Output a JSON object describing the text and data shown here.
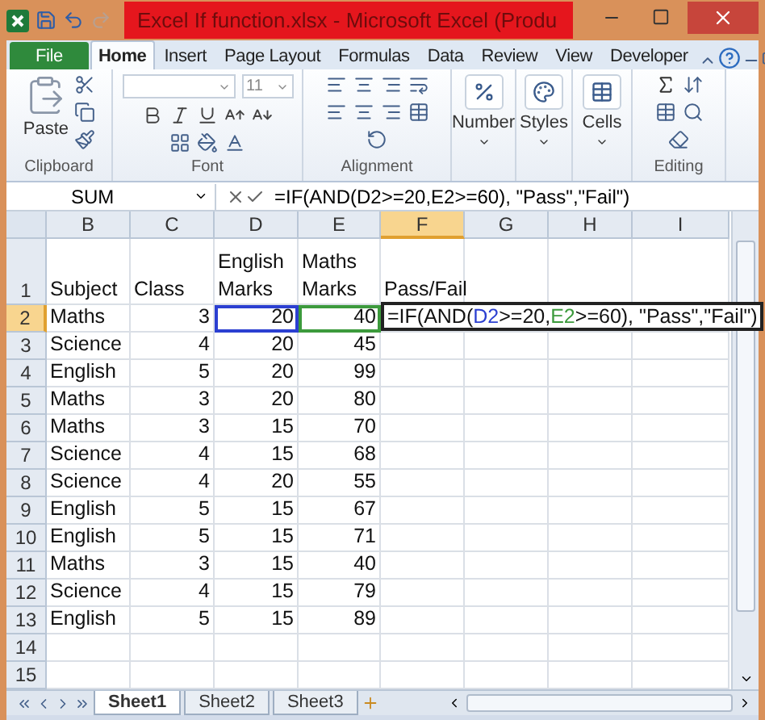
{
  "window": {
    "title": "Excel If function.xlsx - Microsoft Excel (Produ"
  },
  "ribbon_tabs": [
    {
      "label": "File",
      "kind": "file",
      "selected": false
    },
    {
      "label": "Home",
      "kind": "tab",
      "selected": true
    },
    {
      "label": "Insert",
      "kind": "tab",
      "selected": false
    },
    {
      "label": "Page Layout",
      "kind": "tab",
      "selected": false
    },
    {
      "label": "Formulas",
      "kind": "tab",
      "selected": false
    },
    {
      "label": "Data",
      "kind": "tab",
      "selected": false
    },
    {
      "label": "Review",
      "kind": "tab",
      "selected": false
    },
    {
      "label": "View",
      "kind": "tab",
      "selected": false
    },
    {
      "label": "Developer",
      "kind": "tab",
      "selected": false
    }
  ],
  "ribbon_groups": [
    {
      "kind": "clipboard",
      "label": "Clipboard",
      "button": "Paste"
    },
    {
      "kind": "font",
      "label": "Font",
      "font_size": "11"
    },
    {
      "kind": "alignment",
      "label": "Alignment"
    },
    {
      "kind": "number",
      "button": "Number"
    },
    {
      "kind": "styles",
      "button": "Styles"
    },
    {
      "kind": "cells",
      "button": "Cells"
    },
    {
      "kind": "editing",
      "label": "Editing"
    }
  ],
  "formula_bar": {
    "name_box": "SUM",
    "formula": "=IF(AND(D2>=20,E2>=60), \"Pass\",\"Fail\")"
  },
  "sheet": {
    "columns": [
      {
        "label": "B",
        "selected": false
      },
      {
        "label": "C",
        "selected": false
      },
      {
        "label": "D",
        "selected": false
      },
      {
        "label": "E",
        "selected": false
      },
      {
        "label": "F",
        "selected": true
      },
      {
        "label": "G",
        "selected": false
      },
      {
        "label": "H",
        "selected": false
      },
      {
        "label": "I",
        "selected": false
      }
    ],
    "rows": [
      {
        "number": "1",
        "selected": false,
        "cells": [
          {
            "kind": "text",
            "text": "Subject"
          },
          {
            "kind": "text",
            "text": "Class"
          },
          {
            "kind": "text",
            "text": "English Marks"
          },
          {
            "kind": "text",
            "text": "Maths Marks"
          },
          {
            "kind": "text",
            "text": "Pass/Fail"
          }
        ]
      },
      {
        "number": "2",
        "selected": true,
        "cells": [
          {
            "kind": "text",
            "text": "Maths"
          },
          {
            "kind": "number",
            "text": "3"
          },
          {
            "kind": "number",
            "text": "20",
            "color": "#2b3fd1"
          },
          {
            "kind": "number",
            "text": "40",
            "color": "#3c9a3c"
          },
          {
            "kind": "formula",
            "parts": [
              {
                "text": "=IF(AND("
              },
              {
                "text": "D2",
                "color": "#2b3fd1"
              },
              {
                "text": ">=20,"
              },
              {
                "text": "E2",
                "color": "#3c9a3c"
              },
              {
                "text": ">=60), \"Pass\",\"Fail\")"
              }
            ]
          }
        ]
      },
      {
        "number": "3",
        "selected": false,
        "cells": [
          {
            "kind": "text",
            "text": "Science"
          },
          {
            "kind": "number",
            "text": "4"
          },
          {
            "kind": "number",
            "text": "20"
          },
          {
            "kind": "number",
            "text": "45"
          }
        ]
      },
      {
        "number": "4",
        "selected": false,
        "cells": [
          {
            "kind": "text",
            "text": "English"
          },
          {
            "kind": "number",
            "text": "5"
          },
          {
            "kind": "number",
            "text": "20"
          },
          {
            "kind": "number",
            "text": "99"
          }
        ]
      },
      {
        "number": "5",
        "selected": false,
        "cells": [
          {
            "kind": "text",
            "text": "Maths"
          },
          {
            "kind": "number",
            "text": "3"
          },
          {
            "kind": "number",
            "text": "20"
          },
          {
            "kind": "number",
            "text": "80"
          }
        ]
      },
      {
        "number": "6",
        "selected": false,
        "cells": [
          {
            "kind": "text",
            "text": "Maths"
          },
          {
            "kind": "number",
            "text": "3"
          },
          {
            "kind": "number",
            "text": "15"
          },
          {
            "kind": "number",
            "text": "70"
          }
        ]
      },
      {
        "number": "7",
        "selected": false,
        "cells": [
          {
            "kind": "text",
            "text": "Science"
          },
          {
            "kind": "number",
            "text": "4"
          },
          {
            "kind": "number",
            "text": "15"
          },
          {
            "kind": "number",
            "text": "68"
          }
        ]
      },
      {
        "number": "8",
        "selected": false,
        "cells": [
          {
            "kind": "text",
            "text": "Science"
          },
          {
            "kind": "number",
            "text": "4"
          },
          {
            "kind": "number",
            "text": "20"
          },
          {
            "kind": "number",
            "text": "55"
          }
        ]
      },
      {
        "number": "9",
        "selected": false,
        "cells": [
          {
            "kind": "text",
            "text": "English"
          },
          {
            "kind": "number",
            "text": "5"
          },
          {
            "kind": "number",
            "text": "15"
          },
          {
            "kind": "number",
            "text": "67"
          }
        ]
      },
      {
        "number": "10",
        "selected": false,
        "cells": [
          {
            "kind": "text",
            "text": "English"
          },
          {
            "kind": "number",
            "text": "5"
          },
          {
            "kind": "number",
            "text": "15"
          },
          {
            "kind": "number",
            "text": "71"
          }
        ]
      },
      {
        "number": "11",
        "selected": false,
        "cells": [
          {
            "kind": "text",
            "text": "Maths"
          },
          {
            "kind": "number",
            "text": "3"
          },
          {
            "kind": "number",
            "text": "15"
          },
          {
            "kind": "number",
            "text": "40"
          }
        ]
      },
      {
        "number": "12",
        "selected": false,
        "cells": [
          {
            "kind": "text",
            "text": "Science"
          },
          {
            "kind": "number",
            "text": "4"
          },
          {
            "kind": "number",
            "text": "15"
          },
          {
            "kind": "number",
            "text": "79"
          }
        ]
      },
      {
        "number": "13",
        "selected": false,
        "cells": [
          {
            "kind": "text",
            "text": "English"
          },
          {
            "kind": "number",
            "text": "5"
          },
          {
            "kind": "number",
            "text": "15"
          },
          {
            "kind": "number",
            "text": "89"
          }
        ]
      },
      {
        "number": "14",
        "selected": false
      },
      {
        "number": "15",
        "selected": false
      }
    ]
  },
  "sheet_tabs": [
    {
      "label": "Sheet1",
      "selected": true
    },
    {
      "label": "Sheet2",
      "selected": false
    },
    {
      "label": "Sheet3",
      "selected": false
    }
  ]
}
